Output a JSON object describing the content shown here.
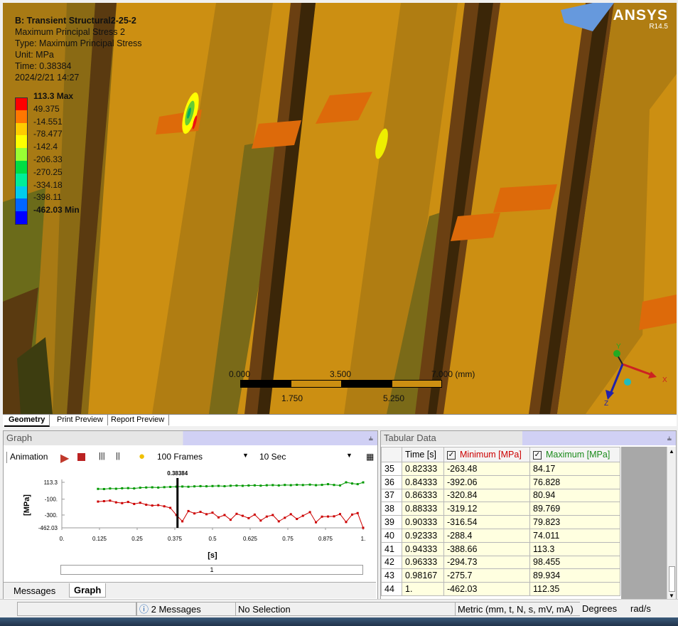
{
  "header": {
    "title": "B: Transient Structural2-25-2",
    "result_name": "Maximum Principal Stress 2",
    "type_line": "Type: Maximum Principal Stress",
    "unit_line": "Unit: MPa",
    "time_line": "Time: 0.38384",
    "date_line": "2024/2/21 14:27"
  },
  "brand": {
    "name": "ANSYS",
    "version": "R14.5"
  },
  "legend": [
    {
      "label": "113.3 Max",
      "color": "#ff0000",
      "bold": true
    },
    {
      "label": "49.375",
      "color": "#ff7700",
      "bold": false
    },
    {
      "label": "-14.551",
      "color": "#ffcc00",
      "bold": false
    },
    {
      "label": "-78.477",
      "color": "#ffff00",
      "bold": false
    },
    {
      "label": "-142.4",
      "color": "#99ff33",
      "bold": false
    },
    {
      "label": "-206.33",
      "color": "#00dd44",
      "bold": false
    },
    {
      "label": "-270.25",
      "color": "#00ee99",
      "bold": false
    },
    {
      "label": "-334.18",
      "color": "#00ccee",
      "bold": false
    },
    {
      "label": "-398.11",
      "color": "#0066ff",
      "bold": false
    },
    {
      "label": "-462.03 Min",
      "color": "#0000ff",
      "bold": true
    }
  ],
  "scalebar": {
    "top_ticks": [
      "0.000",
      "3.500",
      "7.000 (mm)"
    ],
    "bottom_ticks": [
      "1.750",
      "5.250"
    ]
  },
  "triad": {
    "x": "X",
    "y": "Y",
    "z": "Z"
  },
  "view_tabs": [
    "Geometry",
    "Print Preview",
    "Report Preview"
  ],
  "graph_panel": {
    "title": "Graph",
    "animation_label": "Animation",
    "frames": "100 Frames",
    "duration": "10 Sec",
    "tabs": [
      "Messages",
      "Graph"
    ]
  },
  "tabular_panel": {
    "title": "Tabular Data",
    "columns": [
      "Time [s]",
      "Minimum [MPa]",
      "Maximum [MPa]"
    ],
    "rows": [
      {
        "idx": "35",
        "time": "0.82333",
        "min": "-263.48",
        "max": "84.17"
      },
      {
        "idx": "36",
        "time": "0.84333",
        "min": "-392.06",
        "max": "76.828"
      },
      {
        "idx": "37",
        "time": "0.86333",
        "min": "-320.84",
        "max": "80.94"
      },
      {
        "idx": "38",
        "time": "0.88333",
        "min": "-319.12",
        "max": "89.769"
      },
      {
        "idx": "39",
        "time": "0.90333",
        "min": "-316.54",
        "max": "79.823"
      },
      {
        "idx": "40",
        "time": "0.92333",
        "min": "-288.4",
        "max": "74.011"
      },
      {
        "idx": "41",
        "time": "0.94333",
        "min": "-388.66",
        "max": "113.3"
      },
      {
        "idx": "42",
        "time": "0.96333",
        "min": "-294.73",
        "max": "98.455"
      },
      {
        "idx": "43",
        "time": "0.98167",
        "min": "-275.7",
        "max": "89.934"
      },
      {
        "idx": "44",
        "time": "1.",
        "min": "-462.03",
        "max": "112.35"
      }
    ]
  },
  "status": {
    "messages": "2 Messages",
    "selection": "No Selection",
    "units": "Metric (mm, t, N, s, mV, mA)",
    "angle": "Degrees",
    "rot": "rad/s"
  },
  "chart_data": {
    "type": "line",
    "xlabel": "[s]",
    "ylabel": "[MPa]",
    "xlim": [
      0,
      1
    ],
    "ylim": [
      -462.03,
      113.3
    ],
    "x_ticks": [
      "0.",
      "0.125",
      "0.25",
      "0.375",
      "0.5",
      "0.625",
      "0.75",
      "0.875",
      "1."
    ],
    "y_ticks": [
      "113.3",
      "-100.",
      "-300.",
      "-462.03"
    ],
    "cursor": {
      "x": 0.38384,
      "label": "0.38384"
    },
    "slider_label": "1",
    "series": [
      {
        "color": "#009900",
        "x": [
          0.12,
          0.14,
          0.16,
          0.18,
          0.2,
          0.22,
          0.24,
          0.26,
          0.28,
          0.3,
          0.32,
          0.34,
          0.36,
          0.38,
          0.4,
          0.42,
          0.44,
          0.46,
          0.48,
          0.5,
          0.52,
          0.54,
          0.56,
          0.58,
          0.6,
          0.62,
          0.64,
          0.66,
          0.68,
          0.7,
          0.72,
          0.74,
          0.76,
          0.78,
          0.8,
          0.82333,
          0.84333,
          0.86333,
          0.88333,
          0.90333,
          0.92333,
          0.94333,
          0.96333,
          0.98167,
          1.0
        ],
        "values": [
          30,
          28,
          35,
          32,
          38,
          40,
          36,
          45,
          48,
          50,
          47,
          52,
          55,
          58,
          60,
          57,
          62,
          65,
          63,
          66,
          68,
          64,
          70,
          72,
          69,
          73,
          75,
          71,
          76,
          78,
          74,
          80,
          77,
          82,
          79,
          84.17,
          76.828,
          80.94,
          89.769,
          79.823,
          74.011,
          113.3,
          98.455,
          89.934,
          112.35
        ]
      },
      {
        "color": "#cc0000",
        "x": [
          0.12,
          0.14,
          0.16,
          0.18,
          0.2,
          0.22,
          0.24,
          0.26,
          0.28,
          0.3,
          0.32,
          0.34,
          0.36,
          0.38,
          0.4,
          0.42,
          0.44,
          0.46,
          0.48,
          0.5,
          0.52,
          0.54,
          0.56,
          0.58,
          0.6,
          0.62,
          0.64,
          0.66,
          0.68,
          0.7,
          0.72,
          0.74,
          0.76,
          0.78,
          0.8,
          0.82333,
          0.84333,
          0.86333,
          0.88333,
          0.90333,
          0.92333,
          0.94333,
          0.96333,
          0.98167,
          1.0
        ],
        "values": [
          -130,
          -125,
          -118,
          -140,
          -150,
          -135,
          -160,
          -145,
          -170,
          -180,
          -175,
          -190,
          -210,
          -300,
          -380,
          -250,
          -280,
          -260,
          -290,
          -270,
          -330,
          -300,
          -360,
          -285,
          -310,
          -340,
          -295,
          -370,
          -320,
          -300,
          -380,
          -335,
          -290,
          -350,
          -310,
          -263.48,
          -392.06,
          -320.84,
          -319.12,
          -316.54,
          -288.4,
          -388.66,
          -294.73,
          -275.7,
          -462.03
        ]
      }
    ]
  }
}
